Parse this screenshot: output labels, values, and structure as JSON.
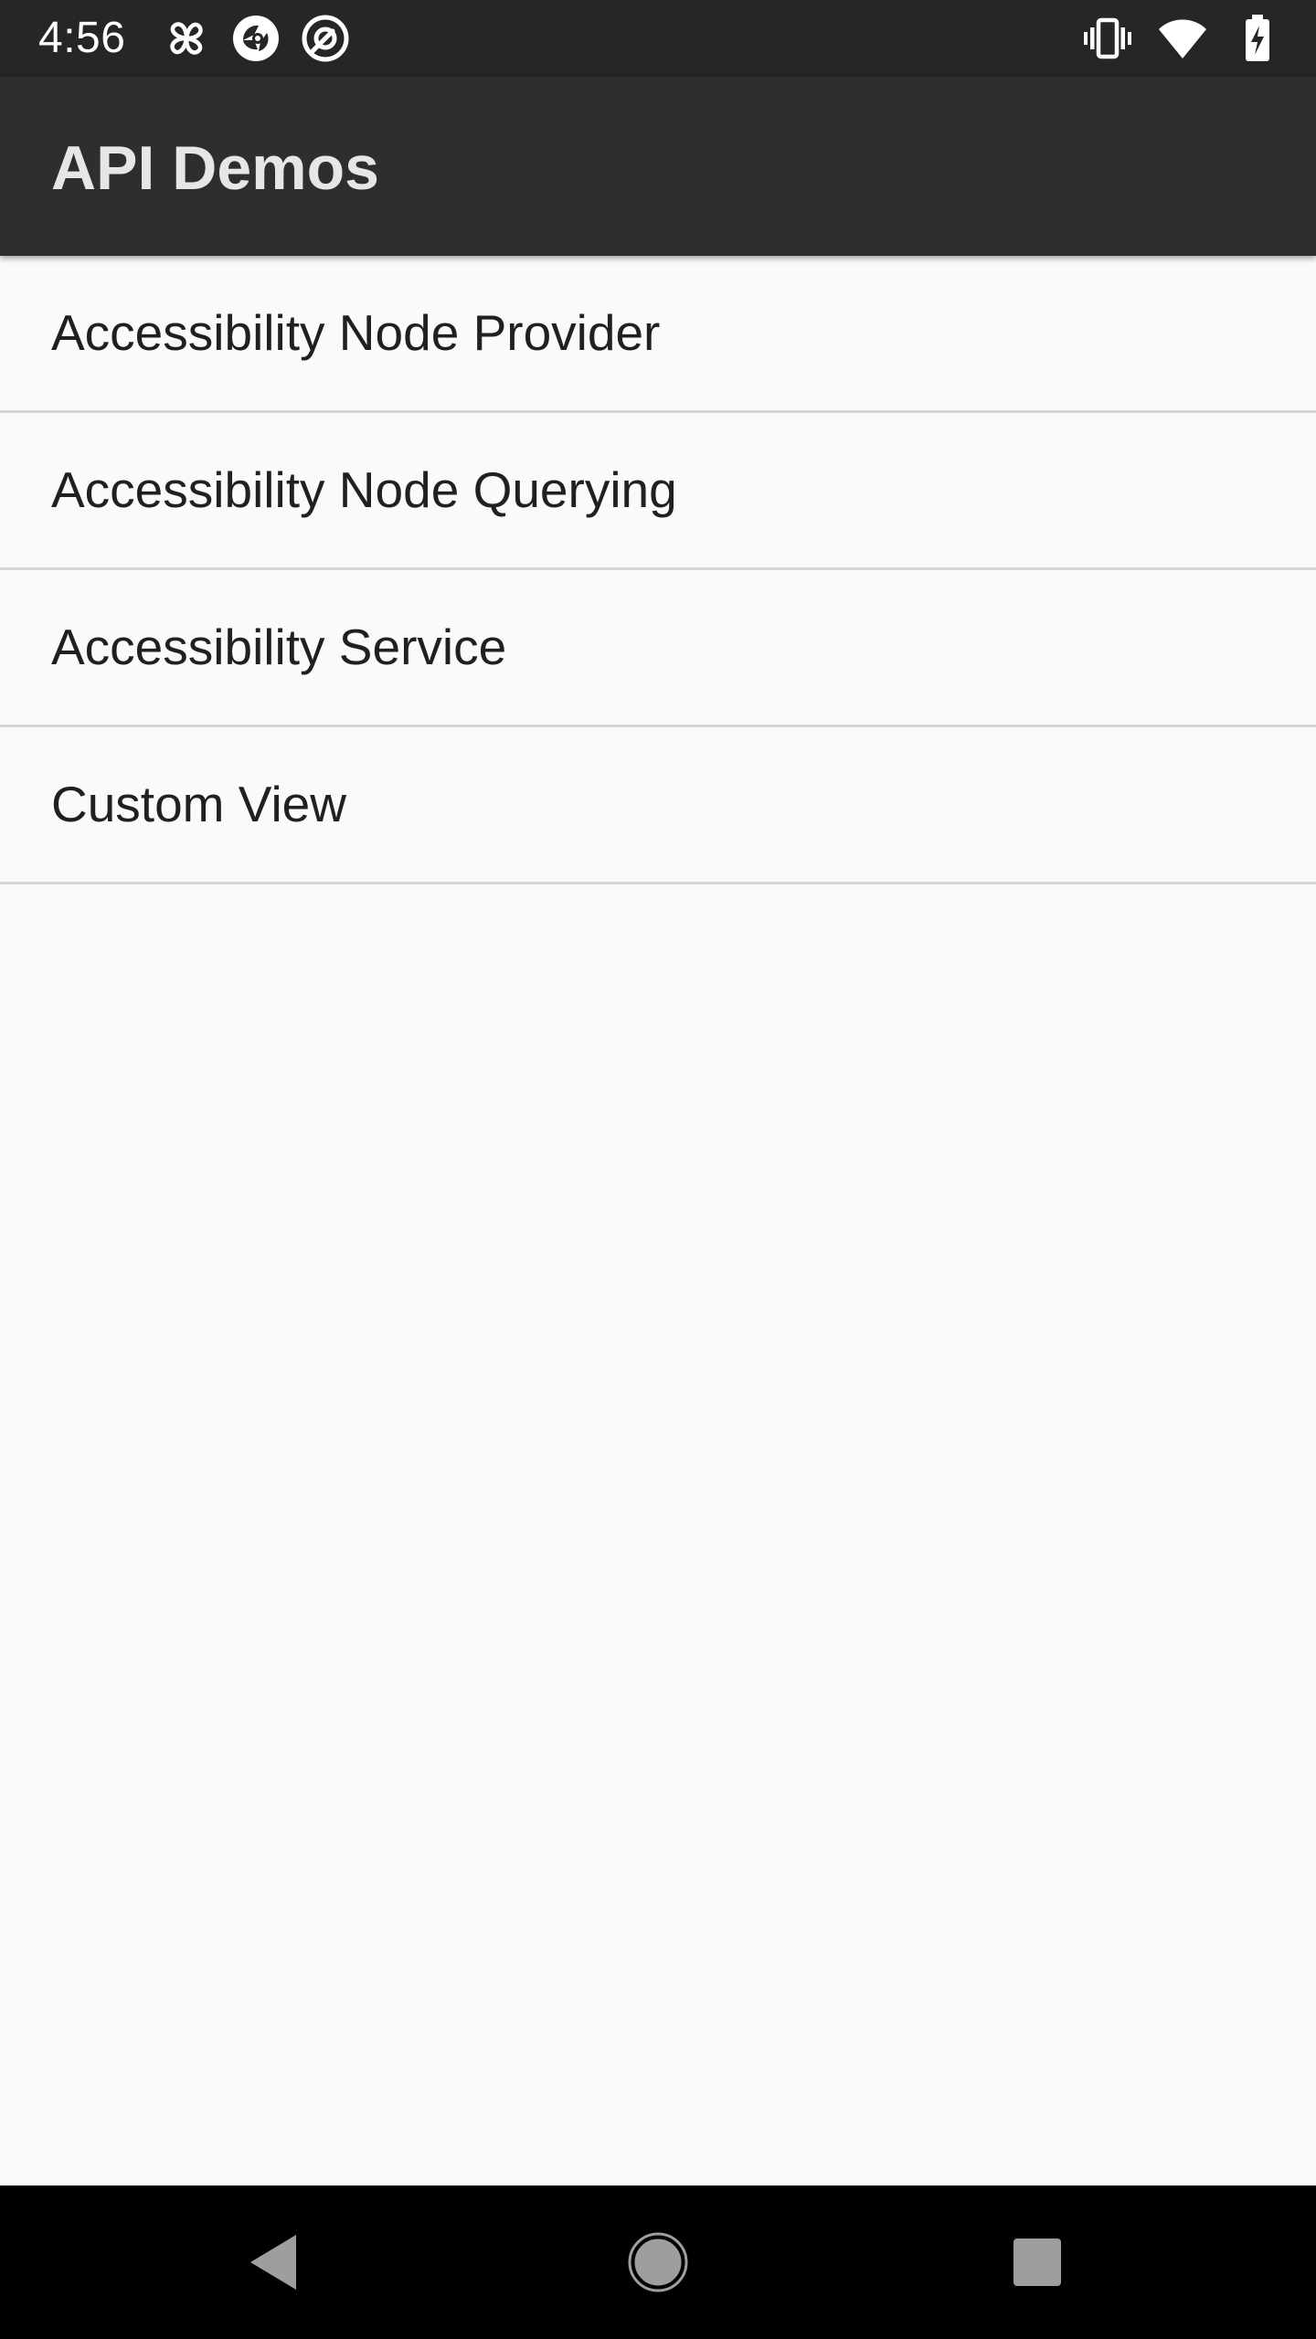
{
  "status_bar": {
    "time": "4:56",
    "left_icons": [
      "pinwheel-icon",
      "camera-shutter-icon",
      "at-sign-icon"
    ],
    "right_icons": [
      "vibrate-icon",
      "wifi-icon",
      "battery-charging-icon"
    ]
  },
  "app_bar": {
    "title": "API Demos"
  },
  "list": {
    "items": [
      {
        "label": "Accessibility Node Provider"
      },
      {
        "label": "Accessibility Node Querying"
      },
      {
        "label": "Accessibility Service"
      },
      {
        "label": "Custom View"
      }
    ]
  },
  "nav_bar": {
    "buttons": [
      "back-icon",
      "home-icon",
      "recents-icon"
    ]
  },
  "colors": {
    "status_bar_bg": "#262626",
    "app_bar_bg": "#2e2e2e",
    "background": "#fafafa",
    "divider": "#d6d6d6",
    "nav_bar_bg": "#000000"
  }
}
